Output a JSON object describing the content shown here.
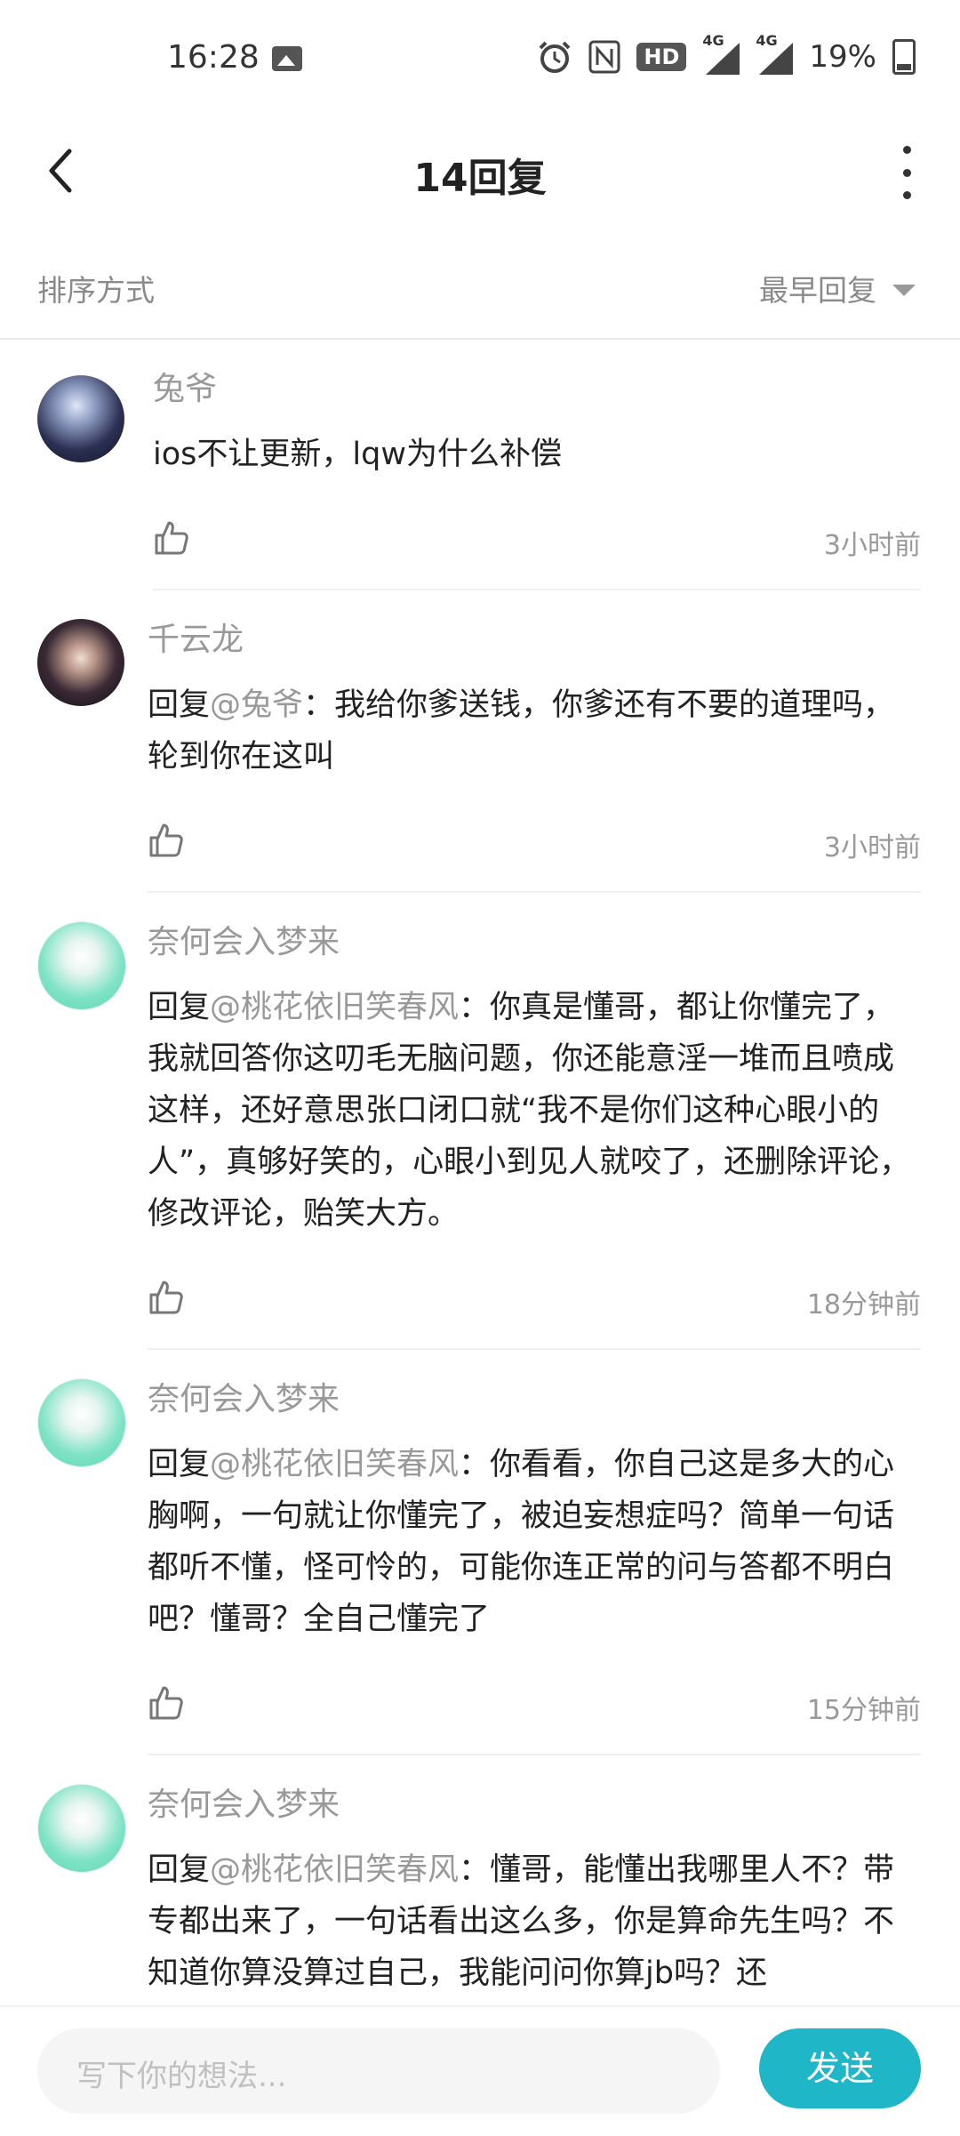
{
  "status_bar": {
    "time": "16:28",
    "hd_label": "HD",
    "sim1_label": "4G",
    "sim2_label": "4G",
    "battery": "19%"
  },
  "header": {
    "title": "14回复"
  },
  "sort": {
    "label": "排序方式",
    "value": "最早回复"
  },
  "comments": [
    {
      "user": "兔爷",
      "reply_prefix": "",
      "mention": "",
      "text": "ios不让更新，lqw为什么补偿",
      "time": "3小时前"
    },
    {
      "user": "千云龙",
      "reply_prefix": "回复",
      "mention": "@兔爷",
      "text": "：我给你爹送钱，你爹还有不要的道理吗，轮到你在这叫",
      "time": "3小时前"
    },
    {
      "user": "奈何会入梦来",
      "reply_prefix": "回复",
      "mention": "@桃花依旧笑春风",
      "text": "：你真是懂哥，都让你懂完了，我就回答你这叨毛无脑问题，你还能意淫一堆而且喷成这样，还好意思张口闭口就“我不是你们这种心眼小的人”，真够好笑的，心眼小到见人就咬了，还删除评论，修改评论，贻笑大方。",
      "time": "18分钟前"
    },
    {
      "user": "奈何会入梦来",
      "reply_prefix": "回复",
      "mention": "@桃花依旧笑春风",
      "text": "：你看看，你自己这是多大的心胸啊，一句就让你懂完了，被迫妄想症吗？简单一句话都听不懂，怪可怜的，可能你连正常的问与答都不明白吧？懂哥？全自己懂完了",
      "time": "15分钟前"
    },
    {
      "user": "奈何会入梦来",
      "reply_prefix": "回复",
      "mention": "@桃花依旧笑春风",
      "text": "：懂哥，能懂出我哪里人不？带专都出来了，一句话看出这么多，你是算命先生吗？不知道你算没算过自己，我能问问你算jb吗？还",
      "time": ""
    }
  ],
  "input": {
    "placeholder": "写下你的想法...",
    "send_label": "发送"
  }
}
